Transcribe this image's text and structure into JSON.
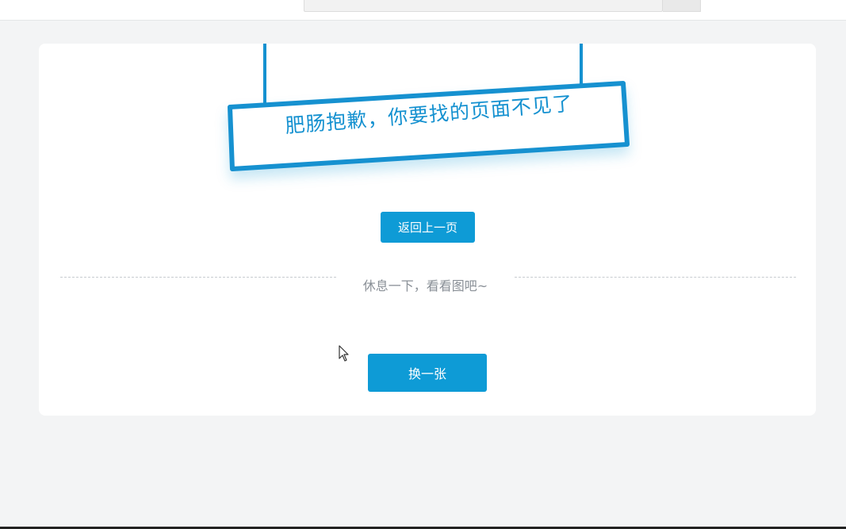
{
  "notfound": {
    "sign_text": "肥肠抱歉，你要找的页面不见了",
    "back_button_label": "返回上一页",
    "divider_text": "休息一下，看看图吧~",
    "change_button_label": "换一张"
  },
  "colors": {
    "accent": "#0e9bd6",
    "sign_stroke": "#1591d0",
    "page_background": "#f3f4f5",
    "card_background": "#ffffff",
    "divider_text": "#8a9097"
  }
}
